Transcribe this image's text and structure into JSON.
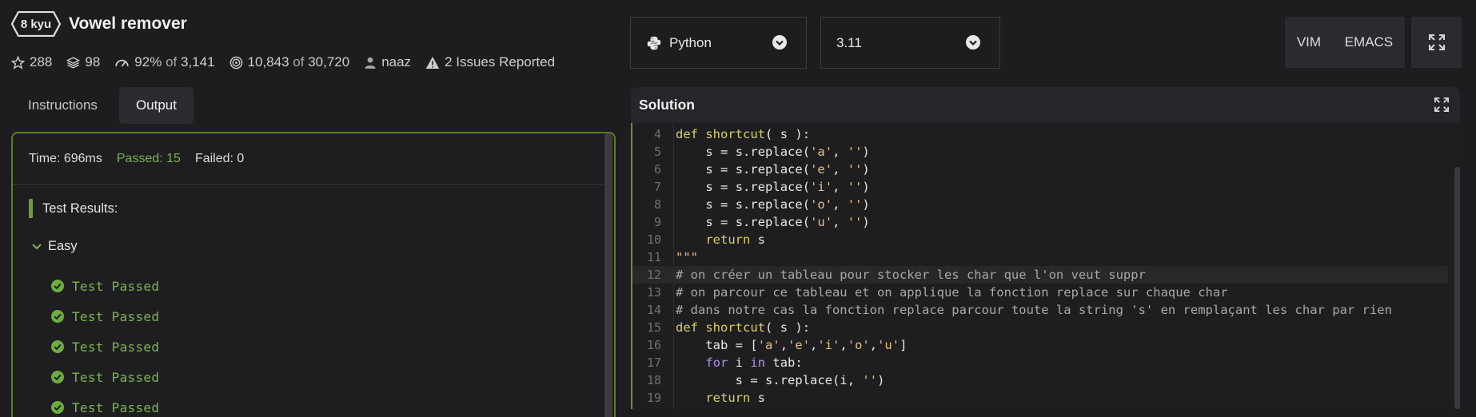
{
  "kata": {
    "rank": "8 kyu",
    "title": "Vowel remover"
  },
  "stats": {
    "stars": "288",
    "collections": "98",
    "satisfaction": "92%",
    "of_word": "of",
    "votes": "3,141",
    "completed": "10,843",
    "attempted": "30,720",
    "author": "naaz",
    "issues": "2 Issues Reported"
  },
  "tabs": [
    {
      "label": "Instructions",
      "active": false
    },
    {
      "label": "Output",
      "active": true
    }
  ],
  "output": {
    "time": "Time: 696ms",
    "passed": "Passed: 15",
    "failed": "Failed: 0",
    "results_title": "Test Results:",
    "group": "Easy",
    "tests": [
      "Test Passed",
      "Test Passed",
      "Test Passed",
      "Test Passed",
      "Test Passed"
    ],
    "colors": {
      "passed": "#77b34a",
      "border": "#5b7d27"
    }
  },
  "language_select": {
    "value": "Python",
    "icon": "python-icon"
  },
  "version_select": {
    "value": "3.11"
  },
  "editor_modes": {
    "vim": "VIM",
    "emacs": "EMACS"
  },
  "solution": {
    "title": "Solution",
    "lines": [
      {
        "n": "4",
        "t": "def shortcut( s ):"
      },
      {
        "n": "5",
        "t": "    s = s.replace('a', '')"
      },
      {
        "n": "6",
        "t": "    s = s.replace('e', '')"
      },
      {
        "n": "7",
        "t": "    s = s.replace('i', '')"
      },
      {
        "n": "8",
        "t": "    s = s.replace('o', '')"
      },
      {
        "n": "9",
        "t": "    s = s.replace('u', '')"
      },
      {
        "n": "10",
        "t": "    return s"
      },
      {
        "n": "11",
        "t": "\"\"\""
      },
      {
        "n": "12",
        "t": "# on créer un tableau pour stocker les char que l'on veut suppr"
      },
      {
        "n": "13",
        "t": "# on parcour ce tableau et on applique la fonction replace sur chaque char"
      },
      {
        "n": "14",
        "t": "# dans notre cas la fonction replace parcour toute la string 's' en remplaçant les char par rien"
      },
      {
        "n": "15",
        "t": "def shortcut( s ):"
      },
      {
        "n": "16",
        "t": "    tab = ['a','e','i','o','u']"
      },
      {
        "n": "17",
        "t": "    for i in tab:"
      },
      {
        "n": "18",
        "t": "        s = s.replace(i, '')"
      },
      {
        "n": "19",
        "t": "    return s"
      }
    ]
  }
}
